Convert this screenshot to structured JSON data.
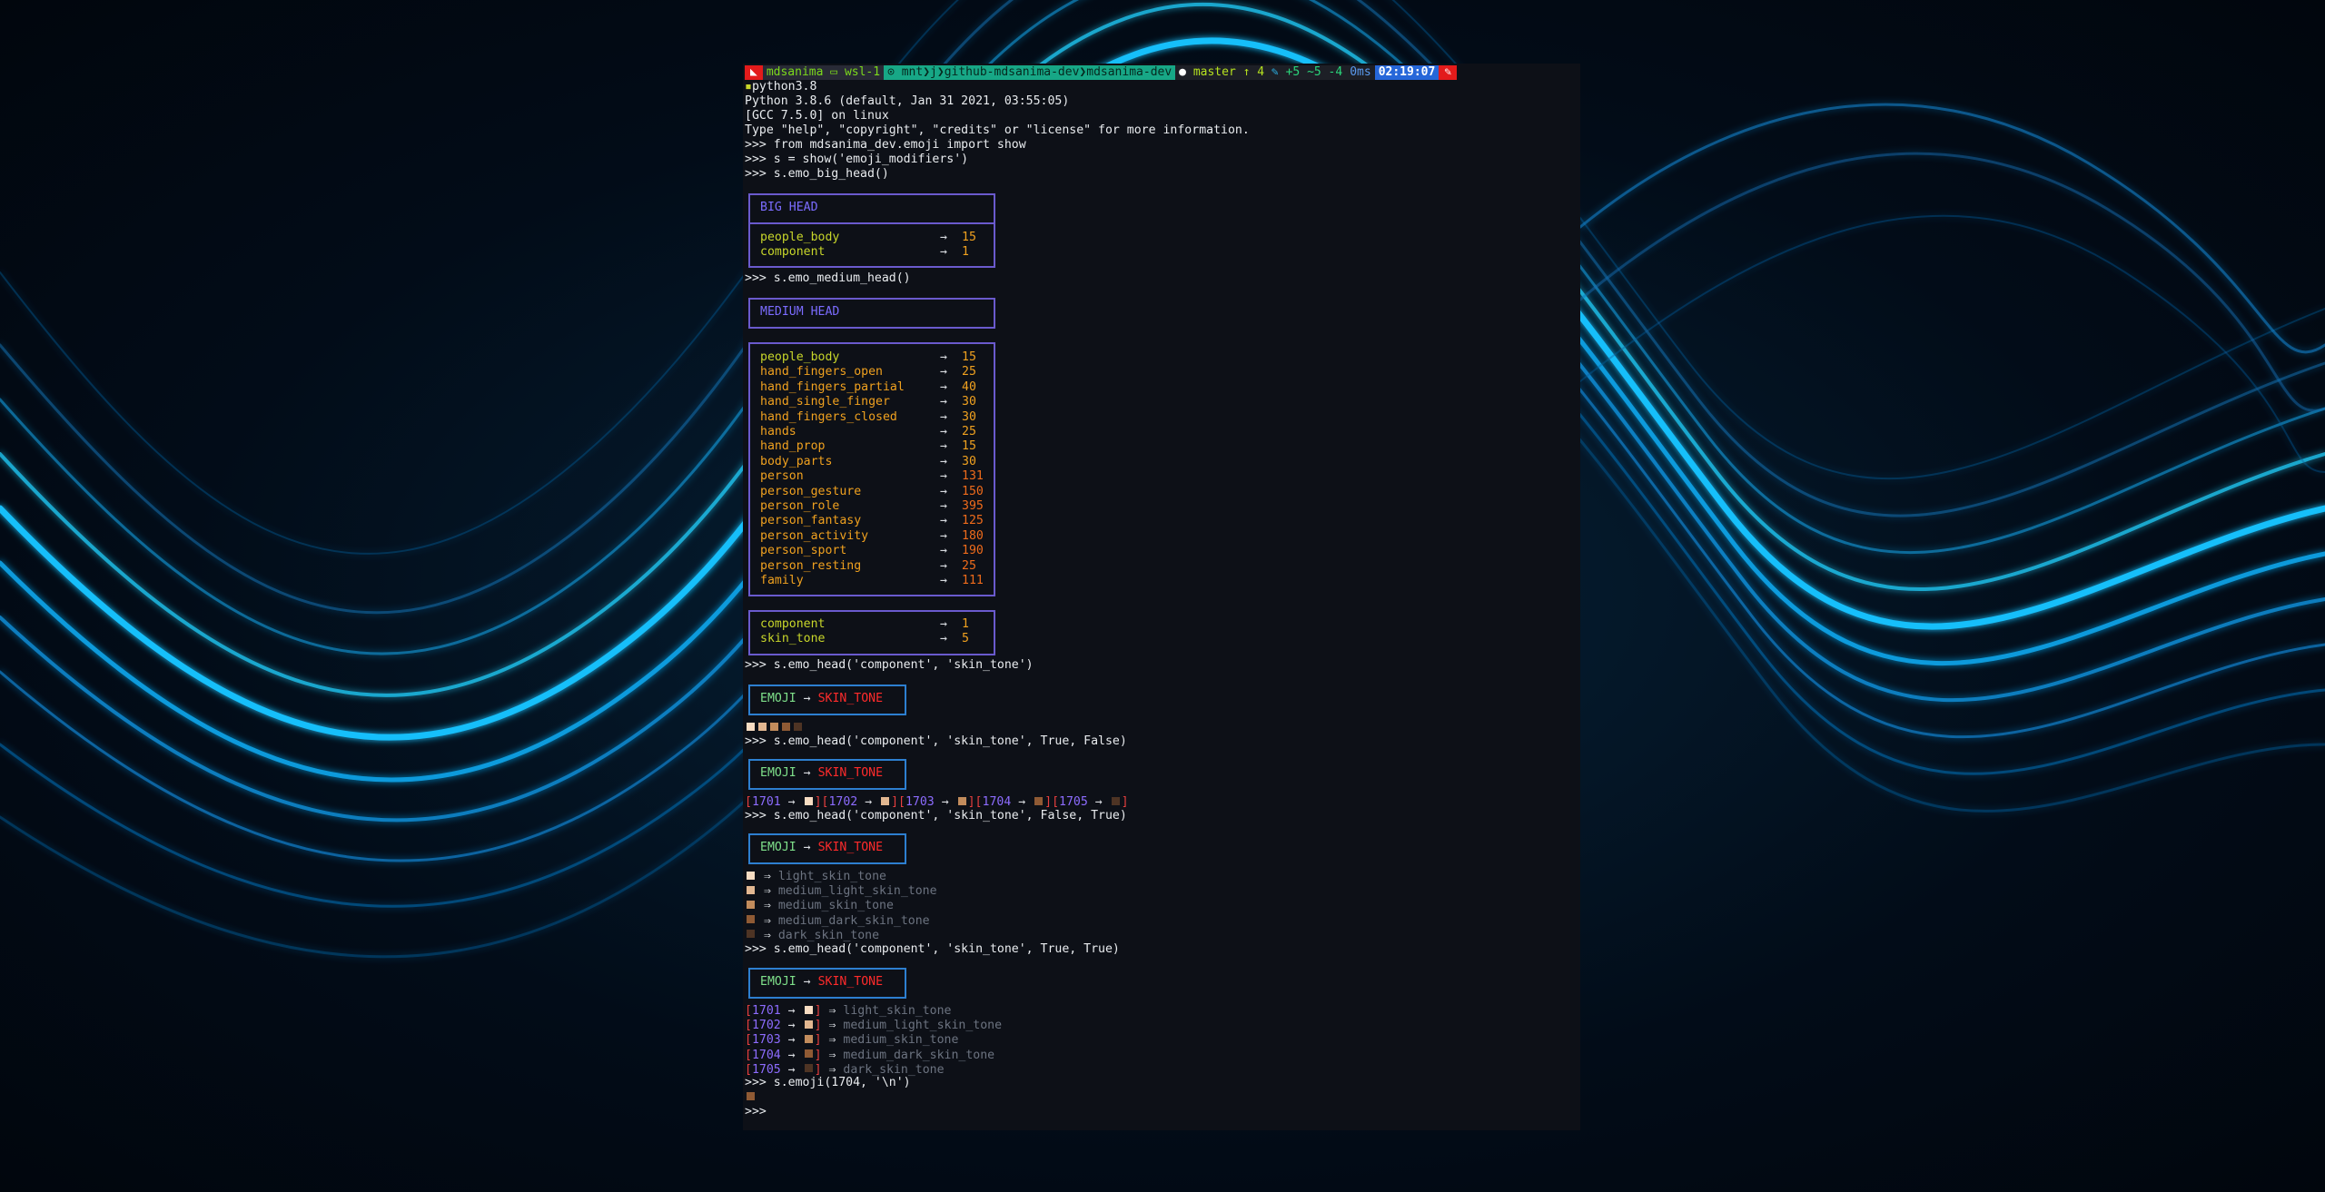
{
  "prompt": {
    "user_host": "mdsanima",
    "host": "wsl-1",
    "path": [
      "mnt",
      "j",
      "github-mdsanima-dev",
      "mdsanima-dev"
    ],
    "branch": "master",
    "git_ahead": "↑ 4",
    "git_stats": "+5 ~5 -4",
    "exec_time": "0ms",
    "clock": "02:19:07",
    "command": "python3.8"
  },
  "python_header": [
    "Python 3.8.6 (default, Jan 31 2021, 03:55:05)",
    "[GCC 7.5.0] on linux",
    "Type \"help\", \"copyright\", \"credits\" or \"license\" for more information."
  ],
  "commands": {
    "c1": ">>> from mdsanima_dev.emoji import show",
    "c2": ">>> s = show('emoji_modifiers')",
    "c3": ">>> s.emo_big_head()",
    "c4": ">>> s.emo_medium_head()",
    "c5": ">>> s.emo_head('component', 'skin_tone')",
    "c6": ">>> s.emo_head('component', 'skin_tone', True, False)",
    "c7": ">>> s.emo_head('component', 'skin_tone', False, True)",
    "c8": ">>> s.emo_head('component', 'skin_tone', True, True)",
    "c9": ">>> s.emoji(1704, '\\n')",
    "c10": ">>>"
  },
  "big_head": {
    "title": "BIG HEAD",
    "rows": [
      {
        "k": "people_body",
        "v": "15"
      },
      {
        "k": "component",
        "v": "1"
      }
    ]
  },
  "medium_head": {
    "title": "MEDIUM HEAD",
    "rows": [
      {
        "k": "people_body",
        "v": "15"
      },
      {
        "k": "hand_fingers_open",
        "v": "25"
      },
      {
        "k": "hand_fingers_partial",
        "v": "40"
      },
      {
        "k": "hand_single_finger",
        "v": "30"
      },
      {
        "k": "hand_fingers_closed",
        "v": "30"
      },
      {
        "k": "hands",
        "v": "25"
      },
      {
        "k": "hand_prop",
        "v": "15"
      },
      {
        "k": "body_parts",
        "v": "30"
      },
      {
        "k": "person",
        "v": "131"
      },
      {
        "k": "person_gesture",
        "v": "150"
      },
      {
        "k": "person_role",
        "v": "395"
      },
      {
        "k": "person_fantasy",
        "v": "125"
      },
      {
        "k": "person_activity",
        "v": "180"
      },
      {
        "k": "person_sport",
        "v": "190"
      },
      {
        "k": "person_resting",
        "v": "25"
      },
      {
        "k": "family",
        "v": "111"
      }
    ],
    "rows2": [
      {
        "k": "component",
        "v": "1"
      },
      {
        "k": "skin_tone",
        "v": "5"
      }
    ]
  },
  "emoji_head": {
    "left": "EMOJI",
    "arrow": "→",
    "right": "SKIN_TONE"
  },
  "arrow": "→",
  "fat_arrow": "⇒",
  "skin_tones": [
    {
      "code": "1701",
      "name": "light_skin_tone",
      "color": "#f7dcc2"
    },
    {
      "code": "1702",
      "name": "medium_light_skin_tone",
      "color": "#e2b791"
    },
    {
      "code": "1703",
      "name": "medium_skin_tone",
      "color": "#c28c5c"
    },
    {
      "code": "1704",
      "name": "medium_dark_skin_tone",
      "color": "#8f5a34"
    },
    {
      "code": "1705",
      "name": "dark_skin_tone",
      "color": "#4e3424"
    }
  ]
}
